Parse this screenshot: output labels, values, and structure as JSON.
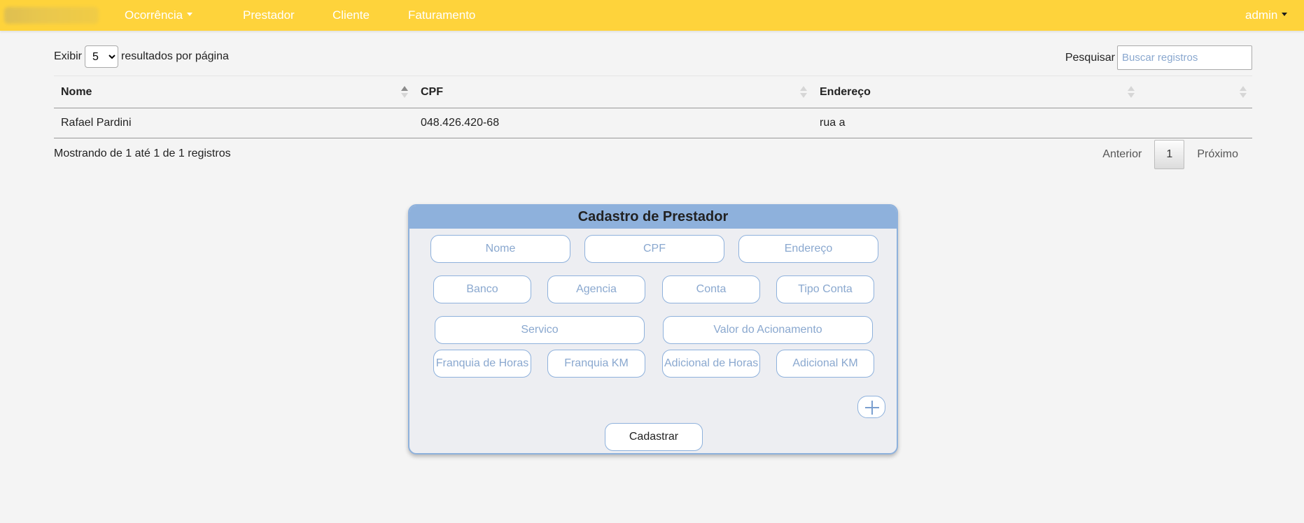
{
  "nav": {
    "menu": [
      {
        "label": "Ocorrência",
        "dropdown": true
      },
      {
        "label": "Prestador"
      },
      {
        "label": "Cliente"
      },
      {
        "label": "Faturamento"
      }
    ],
    "user": "admin"
  },
  "table_controls": {
    "show_label": "Exibir",
    "page_size": "5",
    "page_size_options": [
      "5"
    ],
    "per_page_label": "resultados por página",
    "search_label": "Pesquisar",
    "search_placeholder": "Buscar registros"
  },
  "table": {
    "columns": [
      "Nome",
      "CPF",
      "Endereço",
      ""
    ],
    "rows": [
      [
        "Rafael Pardini",
        "048.426.420-68",
        "rua a",
        ""
      ]
    ],
    "info": "Mostrando de 1 até 1 de 1 registros"
  },
  "pagination": {
    "previous": "Anterior",
    "current": "1",
    "next": "Próximo"
  },
  "form": {
    "title": "Cadastro de Prestador",
    "placeholders": {
      "nome": "Nome",
      "cpf": "CPF",
      "endereco": "Endereço",
      "banco": "Banco",
      "agencia": "Agencia",
      "conta": "Conta",
      "tipo_conta": "Tipo Conta",
      "servico": "Servico",
      "valor_acionamento": "Valor do Acionamento",
      "franquia_horas": "Franquia de Horas",
      "franquia_km": "Franquia KM",
      "adicional_horas": "Adicional de Horas",
      "adicional_km": "Adicional KM"
    },
    "submit_label": "Cadastrar"
  },
  "colors": {
    "navbar": "#fed33b",
    "card_accent": "#8eb1dc",
    "placeholder_text": "#8aa8cf"
  }
}
